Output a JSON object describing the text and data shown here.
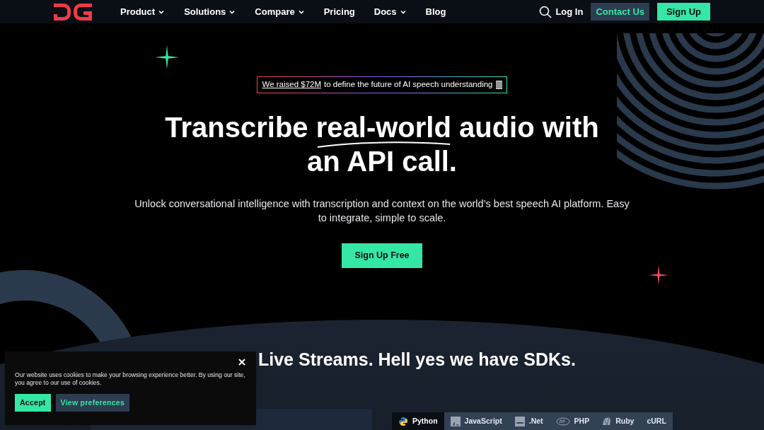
{
  "nav": {
    "menu": [
      {
        "label": "Product",
        "dropdown": true
      },
      {
        "label": "Solutions",
        "dropdown": true
      },
      {
        "label": "Compare",
        "dropdown": true
      },
      {
        "label": "Pricing",
        "dropdown": false
      },
      {
        "label": "Docs",
        "dropdown": true
      },
      {
        "label": "Blog",
        "dropdown": false
      }
    ],
    "login": "Log In",
    "contact": "Contact Us",
    "signup": "Sign Up"
  },
  "announcement": {
    "link": "We raised $72M",
    "text": "to define the future of AI speech understanding"
  },
  "hero": {
    "title_before": "Transcribe",
    "title_highlight": "real-world",
    "title_after": "audio with an API call.",
    "subtitle": "Unlock conversational intelligence with transcription and context on the world’s best speech AI platform. Easy to integrate, simple to scale.",
    "cta": "Sign Up Free"
  },
  "sdk": {
    "heading": "Live Streams. Hell yes we have SDKs.",
    "tabs": [
      {
        "label": "Python",
        "kind": "python",
        "selected": true
      },
      {
        "label": "JavaScript",
        "kind": "js",
        "selected": false
      },
      {
        "label": ".Net",
        "kind": "net",
        "selected": false
      },
      {
        "label": "PHP",
        "kind": "php",
        "selected": false
      },
      {
        "label": "Ruby",
        "kind": "ruby",
        "selected": false
      },
      {
        "label": "cURL",
        "kind": "none",
        "selected": false
      }
    ]
  },
  "cookie": {
    "text": "Our website uses cookies to make your browsing experience better. By using our site, you agree to our use of cookies.",
    "accept": "Accept",
    "preferences": "View preferences"
  }
}
